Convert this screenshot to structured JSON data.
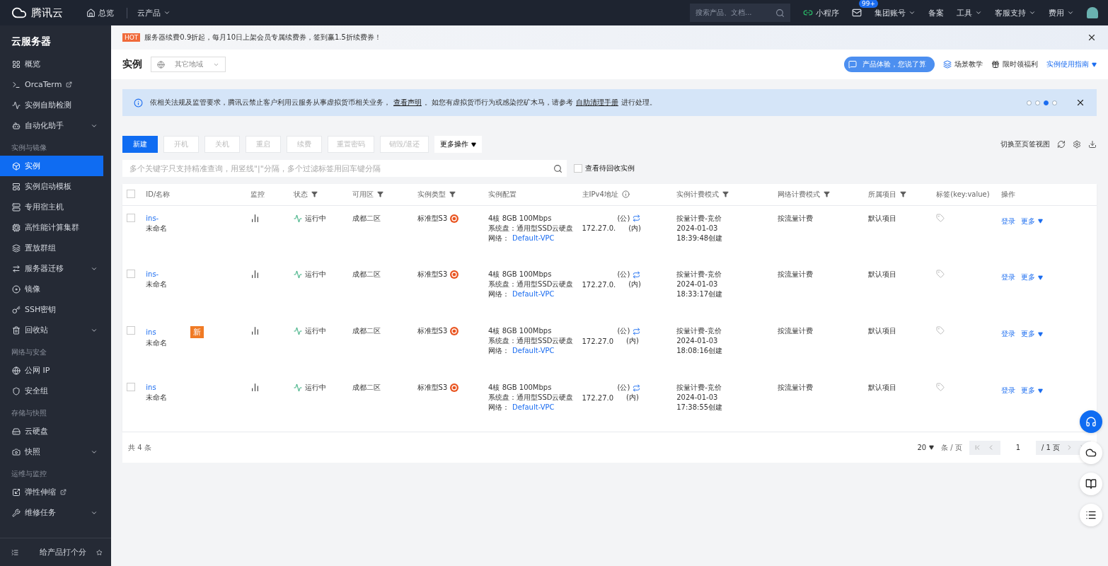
{
  "topbar": {
    "logo": "腾讯云",
    "nav": [
      {
        "label": "总览",
        "kind": "home"
      },
      {
        "label": "云产品",
        "kind": "menu"
      }
    ],
    "search": {
      "placeholder": "搜索产品、文档..."
    },
    "links": [
      {
        "label": "小程序",
        "kind": "mini"
      },
      {
        "kind": "mail",
        "badge": "99+"
      },
      {
        "label": "集团账号",
        "kind": "menu"
      },
      {
        "label": "备案",
        "kind": "plain"
      },
      {
        "label": "工具",
        "kind": "menu"
      },
      {
        "label": "客服支持",
        "kind": "menu"
      },
      {
        "label": "费用",
        "kind": "menu"
      }
    ]
  },
  "sidebar": {
    "title": "云服务器",
    "groups": [
      {
        "items": [
          {
            "label": "概览",
            "selected": false,
            "expandable": false,
            "external": false
          },
          {
            "label": "OrcaTerm",
            "selected": false,
            "expandable": false,
            "external": true
          },
          {
            "label": "实例自助检测",
            "selected": false,
            "expandable": false,
            "external": false
          },
          {
            "label": "自动化助手",
            "selected": false,
            "expandable": true,
            "external": false
          }
        ]
      },
      {
        "heading": "实例与镜像",
        "items": [
          {
            "label": "实例",
            "selected": true,
            "expandable": false,
            "external": false
          },
          {
            "label": "实例启动模板",
            "selected": false,
            "expandable": false,
            "external": false
          },
          {
            "label": "专用宿主机",
            "selected": false,
            "expandable": false,
            "external": false
          },
          {
            "label": "高性能计算集群",
            "selected": false,
            "expandable": false,
            "external": false
          },
          {
            "label": "置放群组",
            "selected": false,
            "expandable": false,
            "external": false
          },
          {
            "label": "服务器迁移",
            "selected": false,
            "expandable": true,
            "external": false
          },
          {
            "label": "镜像",
            "selected": false,
            "expandable": false,
            "external": false
          },
          {
            "label": "SSH密钥",
            "selected": false,
            "expandable": false,
            "external": false
          },
          {
            "label": "回收站",
            "selected": false,
            "expandable": true,
            "external": false
          }
        ]
      },
      {
        "heading": "网络与安全",
        "items": [
          {
            "label": "公网 IP",
            "selected": false,
            "expandable": false,
            "external": false
          },
          {
            "label": "安全组",
            "selected": false,
            "expandable": false,
            "external": false
          }
        ]
      },
      {
        "heading": "存储与快照",
        "items": [
          {
            "label": "云硬盘",
            "selected": false,
            "expandable": false,
            "external": false
          },
          {
            "label": "快照",
            "selected": false,
            "expandable": true,
            "external": false
          }
        ]
      },
      {
        "heading": "运维与监控",
        "items": [
          {
            "label": "弹性伸缩",
            "selected": false,
            "expandable": false,
            "external": true
          },
          {
            "label": "维修任务",
            "selected": false,
            "expandable": true,
            "external": false
          }
        ]
      }
    ],
    "footer": "给产品打个分"
  },
  "promo": {
    "badge": "HOT",
    "text": "服务器续费0.9折起，每月10日上架会员专属续费券，签到赢1.5折续费券！"
  },
  "header": {
    "title": "实例",
    "region": "其它地域",
    "feedback": "产品体验，您说了算",
    "links": [
      {
        "label": "场景教学",
        "kind": "layers"
      },
      {
        "label": "限时领福利",
        "kind": "gift"
      },
      {
        "label": "实例使用指南",
        "kind": "menu"
      }
    ]
  },
  "notice": {
    "parts": [
      {
        "kind": "text",
        "text": "依相关法规及监管要求，腾讯云禁止客户利用云服务从事虚拟货币相关业务，"
      },
      {
        "kind": "link",
        "text": "查看声明"
      },
      {
        "kind": "text",
        "text": "。如您有虚拟货币行为或感染挖矿木马，请参考"
      },
      {
        "kind": "link",
        "text": "自助清理手册"
      },
      {
        "kind": "text",
        "text": "进行处理。"
      }
    ],
    "dots": [
      {
        "selected": false
      },
      {
        "selected": false
      },
      {
        "selected": true
      },
      {
        "selected": false
      }
    ]
  },
  "toolbar": {
    "buttons": [
      {
        "label": "新建",
        "disabled": false
      },
      {
        "label": "开机",
        "disabled": true
      },
      {
        "label": "关机",
        "disabled": true
      },
      {
        "label": "重启",
        "disabled": true
      },
      {
        "label": "续费",
        "disabled": true
      },
      {
        "label": "重置密码",
        "disabled": true
      },
      {
        "label": "销毁/退还",
        "disabled": true
      }
    ],
    "more": "更多操作",
    "switch_view": "切换至页签视图"
  },
  "filter": {
    "placeholder": "多个关键字只支持精准查询，用竖线\"|\"分隔，多个过滤标签用回车键分隔",
    "recycle": {
      "label": "查看待回收实例",
      "checked": false
    }
  },
  "table": {
    "select_all": false,
    "columns": [
      {
        "label": "ID/名称",
        "filter": false,
        "info": false
      },
      {
        "label": "监控",
        "filter": false,
        "info": false
      },
      {
        "label": "状态",
        "filter": true,
        "info": false
      },
      {
        "label": "可用区",
        "filter": true,
        "info": false
      },
      {
        "label": "实例类型",
        "filter": true,
        "info": false
      },
      {
        "label": "实例配置",
        "filter": false,
        "info": false
      },
      {
        "label": "主IPv4地址",
        "filter": false,
        "info": true
      },
      {
        "label": "实例计费模式",
        "filter": true,
        "info": false
      },
      {
        "label": "网络计费模式",
        "filter": true,
        "info": false
      },
      {
        "label": "所属项目",
        "filter": true,
        "info": false
      },
      {
        "label": "标签(key:value)",
        "filter": false,
        "info": false
      },
      {
        "label": "操作",
        "filter": false,
        "info": false
      }
    ],
    "rows": [
      {
        "checked": false,
        "id": "ins-",
        "name": "未命名",
        "badge": "",
        "status": "运行中",
        "zone": "成都二区",
        "type": "标准型S3",
        "config": [
          "4核 8GB 100Mbps",
          "系统盘：通用型SSD云硬盘"
        ],
        "network_label": "网络：",
        "network": "Default-VPC",
        "public_tag": "(公)",
        "private_ip": "172.27.0.",
        "private_tag": "(内)",
        "billing": [
          "按量计费-竞价",
          "2024-01-03",
          "18:39:48创建"
        ],
        "net_billing": "按流量计费",
        "project": "默认项目",
        "actions": [
          "登录",
          "更多"
        ]
      },
      {
        "checked": false,
        "id": "ins-",
        "name": "未命名",
        "badge": "",
        "status": "运行中",
        "zone": "成都二区",
        "type": "标准型S3",
        "config": [
          "4核 8GB 100Mbps",
          "系统盘：通用型SSD云硬盘"
        ],
        "network_label": "网络：",
        "network": "Default-VPC",
        "public_tag": "(公)",
        "private_ip": "172.27.0.",
        "private_tag": "(内)",
        "billing": [
          "按量计费-竞价",
          "2024-01-03",
          "18:33:17创建"
        ],
        "net_billing": "按流量计费",
        "project": "默认项目",
        "actions": [
          "登录",
          "更多"
        ]
      },
      {
        "checked": false,
        "id": "ins",
        "name": "未命名",
        "badge": "新",
        "status": "运行中",
        "zone": "成都二区",
        "type": "标准型S3",
        "config": [
          "4核 8GB 100Mbps",
          "系统盘：通用型SSD云硬盘"
        ],
        "network_label": "网络：",
        "network": "Default-VPC",
        "public_tag": "(公)",
        "private_ip": "172.27.0",
        "private_tag": "(内)",
        "billing": [
          "按量计费-竞价",
          "2024-01-03",
          "18:08:16创建"
        ],
        "net_billing": "按流量计费",
        "project": "默认项目",
        "actions": [
          "登录",
          "更多"
        ]
      },
      {
        "checked": false,
        "id": "ins",
        "name": "未命名",
        "badge": "",
        "status": "运行中",
        "zone": "成都二区",
        "type": "标准型S3",
        "config": [
          "4核 8GB 100Mbps",
          "系统盘：通用型SSD云硬盘"
        ],
        "network_label": "网络：",
        "network": "Default-VPC",
        "public_tag": "(公)",
        "private_ip": "172.27.0",
        "private_tag": "(内)",
        "billing": [
          "按量计费-竞价",
          "2024-01-03",
          "17:38:55创建"
        ],
        "net_billing": "按流量计费",
        "project": "默认项目",
        "actions": [
          "登录",
          "更多"
        ]
      }
    ]
  },
  "pagination": {
    "total": "共 4 条",
    "page_size": "20",
    "per_page": "条 / 页",
    "page": "1",
    "pages": "/ 1 页"
  }
}
